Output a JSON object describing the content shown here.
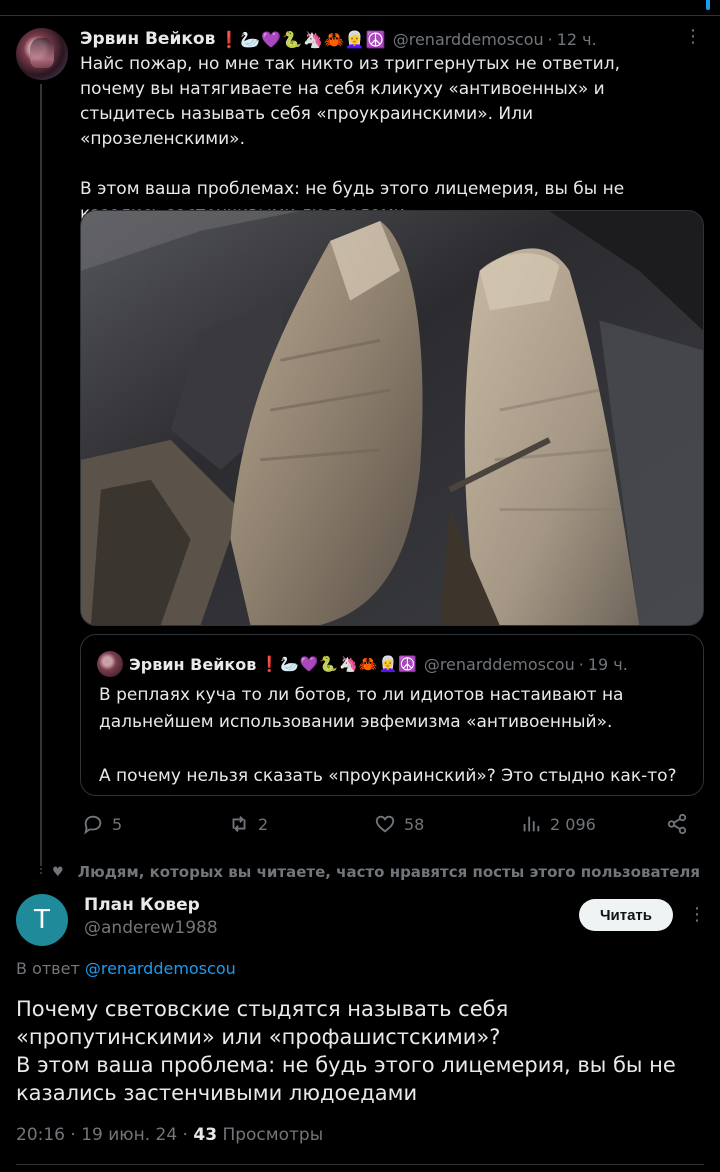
{
  "original_tweet": {
    "author_name": "Эрвин Вейков",
    "author_emojis": "❗🦢💜🐍🦄🦀👩‍🦳☮️",
    "handle": "@renarddemoscou",
    "time": "12 ч.",
    "text_lines": [
      "Найс пожар, но мне так никто из триггернутых не ответил, почему вы натягиваете на себя кликуху «антивоенных» и стыдитесь называть себя «проукраинскими». Или «прозеленскими».",
      "В этом ваша проблемах: не будь этого лицемерия, вы бы не казались застенчивыми людоедами"
    ],
    "actions": {
      "replies": "5",
      "reposts": "2",
      "likes": "58",
      "views": "2 096"
    }
  },
  "quoted_tweet": {
    "author_name": "Эрвин Вейков",
    "author_emojis": "❗🦢💜🐍🦄🦀👩‍🦳☮️",
    "handle": "@renarddemoscou",
    "time": "19 ч.",
    "text_lines": [
      "В реплаях куча то ли ботов, то ли идиотов настаивают на дальнейшем использовании эвфемизма «антивоенный».",
      "А почему нельзя сказать «проукраинский»? Это стыдно как-то?"
    ]
  },
  "social_context": "Людям, которых вы читаете, часто нравятся посты этого пользователя",
  "reply": {
    "avatar_letter": "T",
    "author_name": "План Ковер",
    "handle": "@anderew1988",
    "follow_label": "Читать",
    "reply_to_prefix": "В ответ",
    "reply_to_handle": "@renarddemoscou",
    "text_lines": [
      "Почему световские стыдятся называть себя «пропутинскими» или «профашистскими»?",
      "В этом ваша проблема: не будь этого лицемерия, вы бы не казались застенчивыми людоедами"
    ],
    "timestamp": "20:16 · 19 июн. 24 ·",
    "views_count": "43",
    "views_label": "Просмотры"
  },
  "colors": {
    "background": "#000000",
    "text": "#e7e9ea",
    "muted": "#71767b",
    "link": "#1d9bf0",
    "border": "#2f3336"
  }
}
